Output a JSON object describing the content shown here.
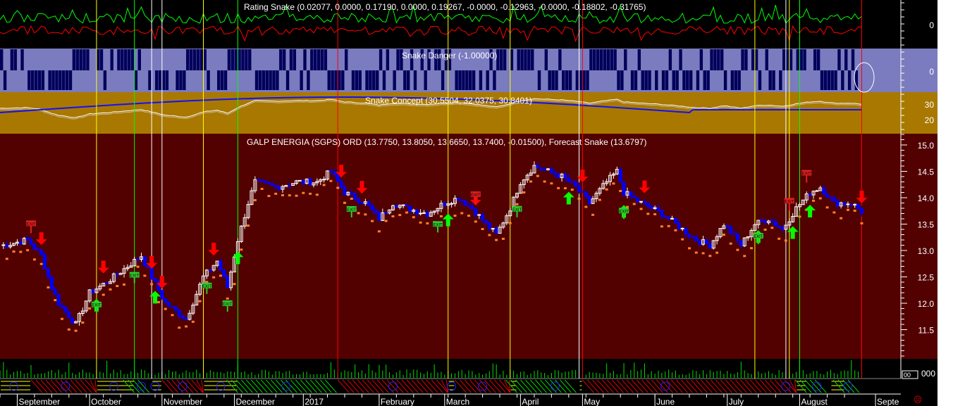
{
  "panels": {
    "rating": {
      "title": "Rating Snake (0.02077, 0.0000, 0.17190, 0.0000, 0.19267, -0.0000, -0.12963, -0.0000, -0.18802, -0.31765)",
      "axis_label": "0"
    },
    "danger": {
      "title": "Snake Danger (-1.00000)",
      "axis_label": "0"
    },
    "concept": {
      "title": "Snake Concept (30.5504, 32.0375, 30.8401)",
      "axis_labels": [
        "30",
        "20"
      ]
    },
    "price": {
      "title": "GALP ENERGIA (SGPS) ORD (13.7750, 13.8050, 13.6650, 13.7400, -0.01500), Forecast Snake (13.6797)"
    },
    "volume": {
      "axis_label": "000",
      "box_label": "00"
    }
  },
  "colors": {
    "price_bg": "#520000",
    "danger_bg": "#7b7bbf",
    "danger_fill": "#00005a",
    "concept_bg": "#a87800",
    "up": "#ffffff",
    "down": "#0000ff",
    "signal_red": "#ff0000",
    "signal_green": "#00ff00",
    "signal_yellow": "#ffff00"
  },
  "sad_icon": "☹",
  "chart_data": {
    "type": "candlestick",
    "title": "GALP ENERGIA (SGPS) ORD",
    "ylim": [
      11.0,
      15.25
    ],
    "yticks": [
      "15.0",
      "14.5",
      "14.0",
      "13.5",
      "13.0",
      "12.5",
      "12.0",
      "11.5"
    ],
    "sessions": 250,
    "close_points": [
      [
        1,
        13.1
      ],
      [
        8,
        13.2
      ],
      [
        12,
        12.9
      ],
      [
        15,
        12.3
      ],
      [
        17,
        12.0
      ],
      [
        22,
        11.6
      ],
      [
        26,
        12.2
      ],
      [
        31,
        12.4
      ],
      [
        37,
        12.7
      ],
      [
        41,
        12.9
      ],
      [
        44,
        12.5
      ],
      [
        48,
        12.0
      ],
      [
        54,
        11.7
      ],
      [
        59,
        12.5
      ],
      [
        63,
        12.8
      ],
      [
        66,
        12.3
      ],
      [
        69,
        13.2
      ],
      [
        72,
        13.9
      ],
      [
        74,
        14.3
      ],
      [
        80,
        14.2
      ],
      [
        86,
        14.3
      ],
      [
        92,
        14.3
      ],
      [
        96,
        14.5
      ],
      [
        100,
        14.1
      ],
      [
        106,
        13.9
      ],
      [
        110,
        13.6
      ],
      [
        114,
        13.9
      ],
      [
        118,
        13.8
      ],
      [
        124,
        13.7
      ],
      [
        129,
        13.9
      ],
      [
        133,
        14.0
      ],
      [
        137,
        13.8
      ],
      [
        141,
        13.5
      ],
      [
        144,
        13.3
      ],
      [
        148,
        13.8
      ],
      [
        151,
        14.3
      ],
      [
        155,
        14.6
      ],
      [
        159,
        14.5
      ],
      [
        163,
        14.4
      ],
      [
        167,
        14.2
      ],
      [
        171,
        13.9
      ],
      [
        176,
        14.3
      ],
      [
        179,
        14.5
      ],
      [
        181,
        14.1
      ],
      [
        186,
        13.9
      ],
      [
        192,
        13.7
      ],
      [
        196,
        13.5
      ],
      [
        202,
        13.2
      ],
      [
        206,
        13.1
      ],
      [
        210,
        13.5
      ],
      [
        215,
        13.1
      ],
      [
        219,
        13.5
      ],
      [
        223,
        13.6
      ],
      [
        227,
        13.4
      ],
      [
        231,
        13.8
      ],
      [
        235,
        14.1
      ],
      [
        238,
        14.2
      ],
      [
        242,
        13.9
      ],
      [
        247,
        13.9
      ],
      [
        250,
        13.74
      ]
    ],
    "months": [
      {
        "s": 5,
        "label": "September"
      },
      {
        "s": 26,
        "label": "October"
      },
      {
        "s": 47,
        "label": "November"
      },
      {
        "s": 68,
        "label": "December"
      },
      {
        "s": 88,
        "label": "2017"
      },
      {
        "s": 110,
        "label": "February"
      },
      {
        "s": 129,
        "label": "March"
      },
      {
        "s": 151,
        "label": "April"
      },
      {
        "s": 169,
        "label": "May"
      },
      {
        "s": 190,
        "label": "June"
      },
      {
        "s": 211,
        "label": "July"
      },
      {
        "s": 232,
        "label": "August"
      },
      {
        "s": 254,
        "label": "Septe"
      }
    ],
    "vlines": {
      "red": [
        98,
        169,
        250
      ],
      "yellow": [
        28,
        59,
        130,
        148,
        219,
        229
      ],
      "green": [
        39,
        69,
        232
      ],
      "white": [
        44,
        47,
        168,
        228
      ]
    },
    "down_arrows": [
      12,
      30,
      44,
      47,
      62,
      99,
      105,
      138,
      169,
      187,
      250
    ],
    "up_arrows": [
      28,
      45,
      69,
      130,
      165,
      181,
      220,
      230,
      235
    ],
    "exit_green": [
      28,
      39,
      60,
      66,
      102,
      127,
      150,
      181,
      220
    ],
    "exit_red": [
      9,
      138,
      229,
      234
    ],
    "exit_label": "EXIT",
    "band": [
      [
        "n",
        0,
        9
      ],
      [
        "r",
        9,
        28
      ],
      [
        "n",
        28,
        39
      ],
      [
        "g",
        39,
        44
      ],
      [
        "n",
        44,
        47
      ],
      [
        "r",
        47,
        59
      ],
      [
        "n",
        59,
        69
      ],
      [
        "g",
        69,
        98
      ],
      [
        "r",
        98,
        130
      ],
      [
        "n",
        130,
        132
      ],
      [
        "r",
        132,
        148
      ],
      [
        "n",
        148,
        150
      ],
      [
        "g",
        150,
        168
      ],
      [
        "n",
        168,
        169
      ],
      [
        "r",
        169,
        231
      ],
      [
        "n",
        231,
        234
      ],
      [
        "g",
        234,
        241
      ],
      [
        "n",
        241,
        245
      ],
      [
        "g",
        245,
        250
      ]
    ],
    "band_faces": [
      [
        4,
        "n"
      ],
      [
        19,
        "r"
      ],
      [
        33,
        "n"
      ],
      [
        41,
        "g"
      ],
      [
        45,
        "n"
      ],
      [
        53,
        "r"
      ],
      [
        64,
        "n"
      ],
      [
        83,
        "g"
      ],
      [
        114,
        "r"
      ],
      [
        131,
        "n"
      ],
      [
        140,
        "r"
      ],
      [
        161,
        "g"
      ],
      [
        193,
        "r"
      ],
      [
        228,
        "g"
      ],
      [
        237,
        "n"
      ],
      [
        246,
        "g"
      ]
    ]
  }
}
